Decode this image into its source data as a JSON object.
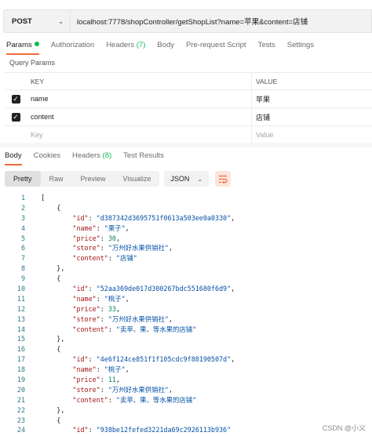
{
  "request": {
    "method": "POST",
    "url": "localhost:7778/shopController/getShopList?name=苹果&content=店铺"
  },
  "request_tabs": [
    {
      "label": "Params",
      "active": true,
      "dot": true
    },
    {
      "label": "Authorization"
    },
    {
      "label": "Headers",
      "count": "(7)"
    },
    {
      "label": "Body"
    },
    {
      "label": "Pre-request Script"
    },
    {
      "label": "Tests"
    },
    {
      "label": "Settings"
    }
  ],
  "query_params": {
    "title": "Query Params",
    "columns": {
      "key": "KEY",
      "value": "VALUE"
    },
    "rows": [
      {
        "key": "name",
        "value": "苹果",
        "checked": true
      },
      {
        "key": "content",
        "value": "店铺",
        "checked": true
      }
    ],
    "placeholder": {
      "key": "Key",
      "value": "Value"
    }
  },
  "response_tabs": [
    {
      "label": "Body",
      "active": true
    },
    {
      "label": "Cookies"
    },
    {
      "label": "Headers",
      "count": "(8)"
    },
    {
      "label": "Test Results"
    }
  ],
  "toolbar": {
    "views": [
      "Pretty",
      "Raw",
      "Preview",
      "Visualize"
    ],
    "active_view": "Pretty",
    "format": "JSON",
    "wrap_icon": "wrap-lines-icon"
  },
  "response_lines": [
    {
      "n": "1",
      "indent": 0,
      "tokens": [
        [
          "t",
          "["
        ]
      ]
    },
    {
      "n": "2",
      "indent": 1,
      "tokens": [
        [
          "t",
          "{"
        ]
      ]
    },
    {
      "n": "3",
      "indent": 2,
      "tokens": [
        [
          "k",
          "\"id\""
        ],
        [
          "t",
          ": "
        ],
        [
          "s",
          "\"d387342d3695751f0613a503ee0a0330\""
        ],
        [
          "t",
          ","
        ]
      ]
    },
    {
      "n": "4",
      "indent": 2,
      "tokens": [
        [
          "k",
          "\"name\""
        ],
        [
          "t",
          ": "
        ],
        [
          "s",
          "\"栗子\""
        ],
        [
          "t",
          ","
        ]
      ]
    },
    {
      "n": "5",
      "indent": 2,
      "tokens": [
        [
          "k",
          "\"price\""
        ],
        [
          "t",
          ": "
        ],
        [
          "n",
          "30"
        ],
        [
          "t",
          ","
        ]
      ]
    },
    {
      "n": "6",
      "indent": 2,
      "tokens": [
        [
          "k",
          "\"store\""
        ],
        [
          "t",
          ": "
        ],
        [
          "s",
          "\"万州好水果供销社\""
        ],
        [
          "t",
          ","
        ]
      ]
    },
    {
      "n": "7",
      "indent": 2,
      "tokens": [
        [
          "k",
          "\"content\""
        ],
        [
          "t",
          ": "
        ],
        [
          "s",
          "\"店铺\""
        ]
      ]
    },
    {
      "n": "8",
      "indent": 1,
      "tokens": [
        [
          "t",
          "},"
        ]
      ]
    },
    {
      "n": "9",
      "indent": 1,
      "tokens": [
        [
          "t",
          "{"
        ]
      ]
    },
    {
      "n": "10",
      "indent": 2,
      "tokens": [
        [
          "k",
          "\"id\""
        ],
        [
          "t",
          ": "
        ],
        [
          "s",
          "\"52aa369de017d300267bdc551680f6d9\""
        ],
        [
          "t",
          ","
        ]
      ]
    },
    {
      "n": "11",
      "indent": 2,
      "tokens": [
        [
          "k",
          "\"name\""
        ],
        [
          "t",
          ": "
        ],
        [
          "s",
          "\"桃子\""
        ],
        [
          "t",
          ","
        ]
      ]
    },
    {
      "n": "12",
      "indent": 2,
      "tokens": [
        [
          "k",
          "\"price\""
        ],
        [
          "t",
          ": "
        ],
        [
          "n",
          "33"
        ],
        [
          "t",
          ","
        ]
      ]
    },
    {
      "n": "13",
      "indent": 2,
      "tokens": [
        [
          "k",
          "\"store\""
        ],
        [
          "t",
          ": "
        ],
        [
          "s",
          "\"万州好水果供销社\""
        ],
        [
          "t",
          ","
        ]
      ]
    },
    {
      "n": "14",
      "indent": 2,
      "tokens": [
        [
          "k",
          "\"content\""
        ],
        [
          "t",
          ": "
        ],
        [
          "s",
          "\"卖苹、果、等水果的店铺\""
        ]
      ]
    },
    {
      "n": "15",
      "indent": 1,
      "tokens": [
        [
          "t",
          "},"
        ]
      ]
    },
    {
      "n": "16",
      "indent": 1,
      "tokens": [
        [
          "t",
          "{"
        ]
      ]
    },
    {
      "n": "17",
      "indent": 2,
      "tokens": [
        [
          "k",
          "\"id\""
        ],
        [
          "t",
          ": "
        ],
        [
          "s",
          "\"4e6f124ce851f1f105cdc9f88190507d\""
        ],
        [
          "t",
          ","
        ]
      ]
    },
    {
      "n": "18",
      "indent": 2,
      "tokens": [
        [
          "k",
          "\"name\""
        ],
        [
          "t",
          ": "
        ],
        [
          "s",
          "\"桃子\""
        ],
        [
          "t",
          ","
        ]
      ]
    },
    {
      "n": "19",
      "indent": 2,
      "tokens": [
        [
          "k",
          "\"price\""
        ],
        [
          "t",
          ": "
        ],
        [
          "n",
          "11"
        ],
        [
          "t",
          ","
        ]
      ]
    },
    {
      "n": "20",
      "indent": 2,
      "tokens": [
        [
          "k",
          "\"store\""
        ],
        [
          "t",
          ": "
        ],
        [
          "s",
          "\"万州好水果供销社\""
        ],
        [
          "t",
          ","
        ]
      ]
    },
    {
      "n": "21",
      "indent": 2,
      "tokens": [
        [
          "k",
          "\"content\""
        ],
        [
          "t",
          ": "
        ],
        [
          "s",
          "\"卖苹、果、等水果的店铺\""
        ]
      ]
    },
    {
      "n": "22",
      "indent": 1,
      "tokens": [
        [
          "t",
          "},"
        ]
      ]
    },
    {
      "n": "23",
      "indent": 1,
      "tokens": [
        [
          "t",
          "{"
        ]
      ]
    },
    {
      "n": "24",
      "indent": 2,
      "tokens": [
        [
          "k",
          "\"id\""
        ],
        [
          "t",
          ": "
        ],
        [
          "s",
          "\"938be12fefed3221da69c2926113b936\""
        ]
      ]
    }
  ],
  "watermark": "CSDN @小义"
}
